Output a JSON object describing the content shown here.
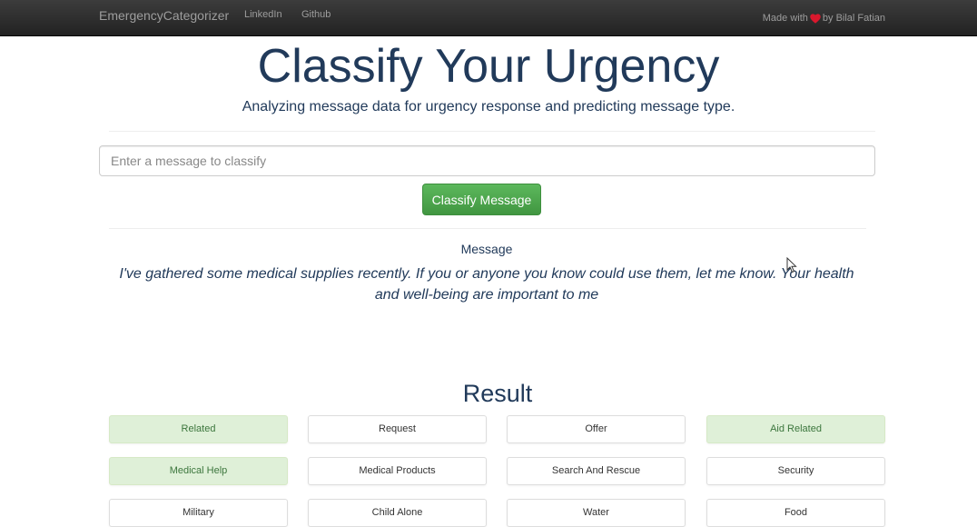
{
  "navbar": {
    "brand": "EmergencyCategorizer",
    "links": [
      "LinkedIn",
      "Github"
    ],
    "made_with_prefix": "Made with",
    "made_with_suffix": "by Bilal Fatian",
    "heart_icon": "heart-icon",
    "heart_color": "#d9182d"
  },
  "header": {
    "title": "Classify Your Urgency",
    "subtitle": "Analyzing message data for urgency response and predicting message type."
  },
  "form": {
    "input_value": "",
    "input_placeholder": "Enter a message to classify",
    "button_label": "Classify Message"
  },
  "message": {
    "label": "Message",
    "text": "I've gathered some medical supplies recently. If you or anyone you know could use them, let me know. Your health and well-being are important to me"
  },
  "result": {
    "title": "Result",
    "categories": [
      {
        "label": "Related",
        "active": true
      },
      {
        "label": "Request",
        "active": false
      },
      {
        "label": "Offer",
        "active": false
      },
      {
        "label": "Aid Related",
        "active": true
      },
      {
        "label": "Medical Help",
        "active": true
      },
      {
        "label": "Medical Products",
        "active": false
      },
      {
        "label": "Search And Rescue",
        "active": false
      },
      {
        "label": "Security",
        "active": false
      },
      {
        "label": "Military",
        "active": false
      },
      {
        "label": "Child Alone",
        "active": false
      },
      {
        "label": "Water",
        "active": false
      },
      {
        "label": "Food",
        "active": false
      }
    ]
  },
  "colors": {
    "accent_text": "#213a5a",
    "success_button": "#5cb85c",
    "active_category_bg": "#dff0d8",
    "active_category_text": "#3c763d"
  }
}
